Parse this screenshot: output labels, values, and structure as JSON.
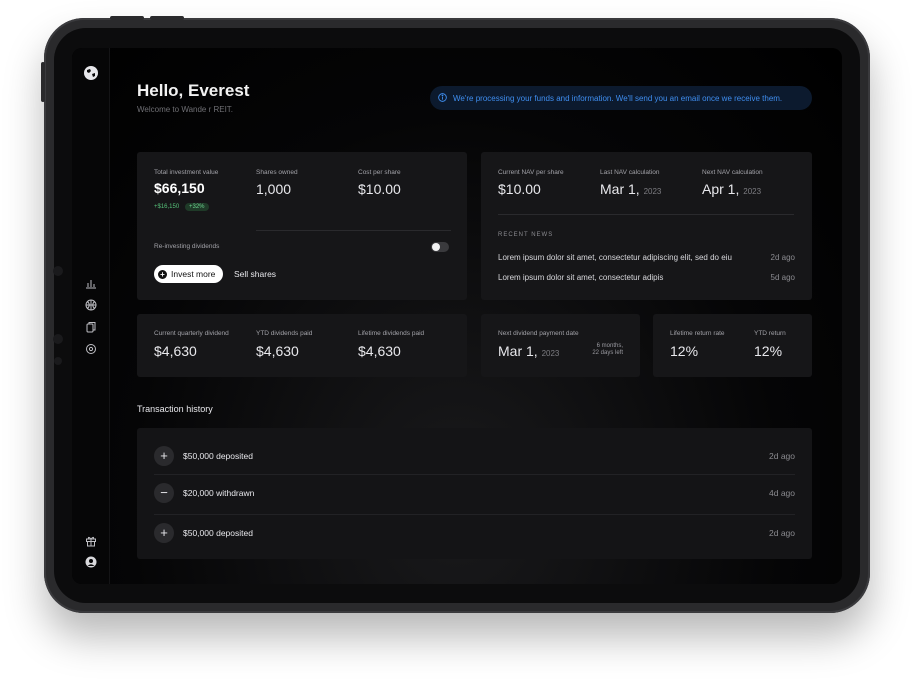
{
  "header": {
    "greeting": "Hello, Everest",
    "welcome": "Welcome to Wande r REIT."
  },
  "notice": {
    "text": "We're processing your funds and information. We'll send you an email once we receive them."
  },
  "investment": {
    "total_label": "Total investment value",
    "total_value": "$66,150",
    "gain": "+$16,150",
    "gain_pct": "+32%",
    "shares_label": "Shares owned",
    "shares_value": "1,000",
    "cost_label": "Cost per share",
    "cost_value": "$10.00",
    "reinvest_label": "Re-investing dividends",
    "invest_more": "Invest more",
    "sell_shares": "Sell shares"
  },
  "nav": {
    "current_label": "Current NAV per share",
    "current_value": "$10.00",
    "last_label": "Last NAV calculation",
    "last_value": "Mar 1,",
    "last_year": "2023",
    "next_label": "Next NAV calculation",
    "next_value": "Apr 1,",
    "next_year": "2023"
  },
  "news": {
    "heading": "RECENT NEWS",
    "items": [
      {
        "text": "Lorem ipsum dolor sit amet, consectetur adipiscing elit, sed do eiu",
        "time": "2d ago"
      },
      {
        "text": "Lorem ipsum dolor sit amet, consectetur adipis",
        "time": "5d ago"
      }
    ]
  },
  "dividends": {
    "quarterly_label": "Current quarterly dividend",
    "quarterly_value": "$4,630",
    "ytd_label": "YTD dividends paid",
    "ytd_value": "$4,630",
    "lifetime_label": "Lifetime dividends paid",
    "lifetime_value": "$4,630"
  },
  "payment": {
    "label": "Next dividend payment date",
    "value": "Mar 1,",
    "year": "2023",
    "countdown_line1": "6 months,",
    "countdown_line2": "22 days left"
  },
  "returns": {
    "lifetime_label": "Lifetime return rate",
    "lifetime_value": "12%",
    "ytd_label": "YTD return",
    "ytd_value": "12%"
  },
  "transactions": {
    "title": "Transaction history",
    "items": [
      {
        "icon": "+",
        "label": "$50,000 deposited",
        "time": "2d ago"
      },
      {
        "icon": "−",
        "label": "$20,000 withdrawn",
        "time": "4d ago"
      },
      {
        "icon": "+",
        "label": "$50,000 deposited",
        "time": "2d ago"
      }
    ]
  },
  "sidebar": {
    "icons": [
      "globe-logo-icon",
      "chart-icon",
      "basketball-icon",
      "documents-icon",
      "settings-icon",
      "gift-icon",
      "avatar-icon"
    ]
  },
  "colors": {
    "accent_blue": "#3f8ef0",
    "gain_green": "#57c27a",
    "card_bg": "#161618"
  }
}
